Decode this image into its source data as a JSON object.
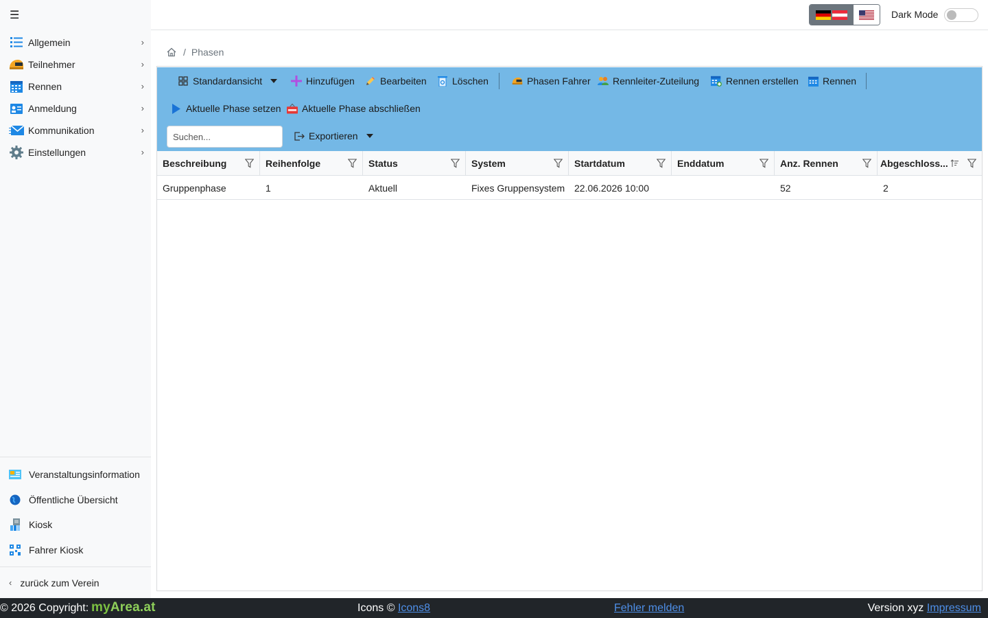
{
  "sidebar": {
    "menu_icon": "hamburger-icon",
    "items": [
      {
        "label": "Allgemein",
        "icon": "list-icon"
      },
      {
        "label": "Teilnehmer",
        "icon": "helmet-icon"
      },
      {
        "label": "Rennen",
        "icon": "calendar-icon"
      },
      {
        "label": "Anmeldung",
        "icon": "id-card-icon"
      },
      {
        "label": "Kommunikation",
        "icon": "mail-icon"
      },
      {
        "label": "Einstellungen",
        "icon": "gear-icon"
      }
    ],
    "bottom_items": [
      {
        "label": "Veranstaltungsinformation",
        "icon": "info-board-icon"
      },
      {
        "label": "Öffentliche Übersicht",
        "icon": "globe-icon"
      },
      {
        "label": "Kiosk",
        "icon": "kiosk-icon"
      },
      {
        "label": "Fahrer Kiosk",
        "icon": "qr-code-icon"
      }
    ],
    "back_label": "zurück zum Verein"
  },
  "topbar": {
    "languages": [
      "de-at",
      "en-us"
    ],
    "dark_mode_label": "Dark Mode",
    "dark_mode_on": false
  },
  "breadcrumb": {
    "current": "Phasen",
    "separator": "/"
  },
  "toolbar": {
    "view_label": "Standardansicht",
    "add_label": "Hinzufügen",
    "edit_label": "Bearbeiten",
    "delete_label": "Löschen",
    "phase_drivers_label": "Phasen Fahrer",
    "race_director_label": "Rennleiter-Zuteilung",
    "create_races_label": "Rennen erstellen",
    "races_label": "Rennen",
    "set_phase_label": "Aktuelle Phase setzen",
    "close_phase_label": "Aktuelle Phase abschließen",
    "search_placeholder": "Suchen...",
    "export_label": "Exportieren",
    "colors": {
      "toolbar_bg": "#74b8e6",
      "add_icon": "#b14fe0",
      "play_icon": "#1a73d6"
    }
  },
  "table": {
    "columns": [
      "Beschreibung",
      "Reihenfolge",
      "Status",
      "System",
      "Startdatum",
      "Enddatum",
      "Anz. Rennen",
      "Abgeschloss..."
    ],
    "rows": [
      [
        "Gruppenphase",
        "1",
        "Aktuell",
        "Fixes Gruppensystem",
        "22.06.2026 10:00",
        "",
        "52",
        "2"
      ]
    ]
  },
  "footer": {
    "copyright": "© 2026 Copyright:",
    "brand_my": "my",
    "brand_rest": "Area.at",
    "icons_prefix": "Icons ©",
    "icons_link": "Icons8",
    "report_link": "Fehler melden",
    "version": "Version xyz",
    "impressum_link": "Impressum"
  }
}
